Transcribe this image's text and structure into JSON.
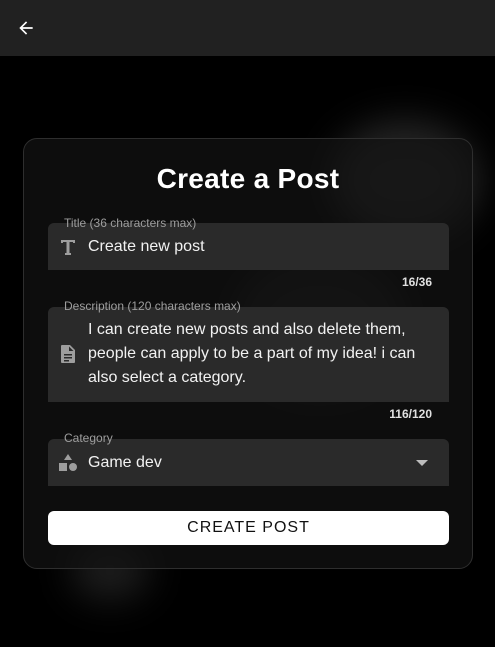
{
  "header": {
    "back_icon": "arrow-left-icon"
  },
  "form": {
    "title": "Create a Post",
    "title_field": {
      "label": "Title (36 characters max)",
      "value": "Create new post",
      "counter": "16/36",
      "icon": "text-title-icon"
    },
    "description_field": {
      "label": "Description (120 characters max)",
      "value": "I can create new posts and also delete them, people can apply to be a part of my idea! i can also select a category.",
      "counter": "116/120",
      "icon": "document-icon"
    },
    "category_field": {
      "label": "Category",
      "value": "Game dev",
      "icon": "shapes-icon"
    },
    "submit_label": "CREATE POST"
  },
  "colors": {
    "background": "#000000",
    "appbar": "#212121",
    "field": "#2a2a2a",
    "button": "#ffffff"
  }
}
